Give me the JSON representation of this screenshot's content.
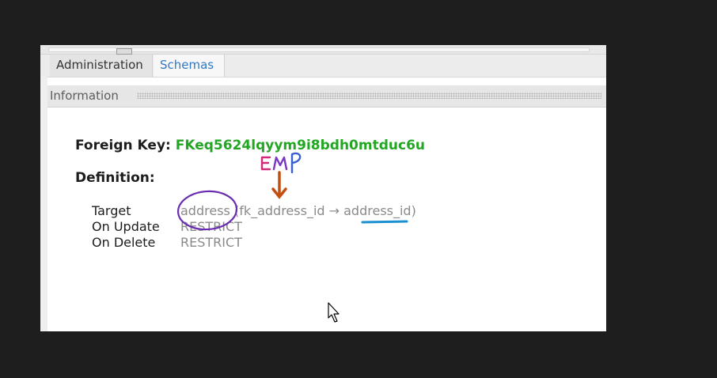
{
  "tabs": {
    "administration": "Administration",
    "schemas": "Schemas"
  },
  "info": {
    "title": "Information"
  },
  "foreign_key": {
    "label": "Foreign Key:",
    "name": "FKeq5624lqyym9i8bdh0mtduc6u"
  },
  "definition": {
    "title": "Definition:",
    "rows": [
      {
        "key": "Target",
        "value": "address (fk_address_id → address_id)"
      },
      {
        "key": "On Update",
        "value": "RESTRICT"
      },
      {
        "key": "On Delete",
        "value": "RESTRICT"
      }
    ]
  },
  "annotation": {
    "text": "EMP"
  },
  "colors": {
    "fk_name": "#23a623",
    "tab_active": "#2f78c4",
    "circle": "#6a2db0",
    "arrow": "#c24f10",
    "underline": "#1a8fd1"
  }
}
